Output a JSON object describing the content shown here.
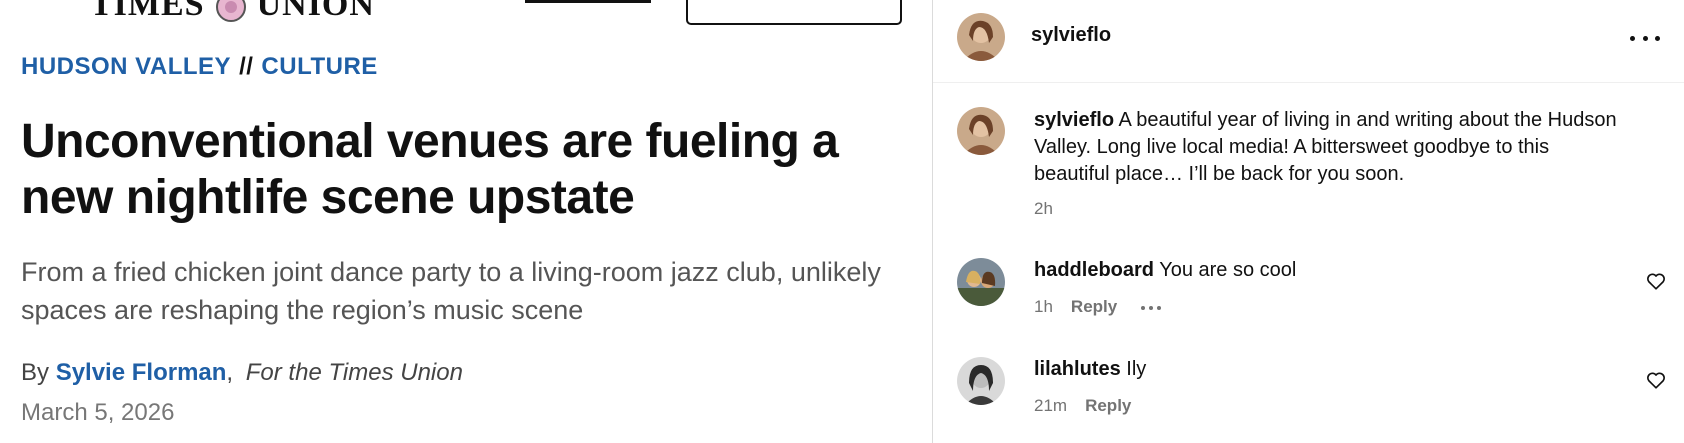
{
  "article": {
    "masthead_left": "TIMES",
    "masthead_right": "UNION",
    "kicker_section1": "HUDSON VALLEY",
    "kicker_separator": "//",
    "kicker_section2": "CULTURE",
    "headline": "Unconventional venues are fueling a new nightlife scene upstate",
    "dek": "From a fried chicken joint dance party to a living-room jazz club, unlikely spaces are reshaping the region’s music scene",
    "byline_prefix": "By",
    "author": "Sylvie Florman",
    "byline_comma": ",",
    "byline_for": "For the Times Union",
    "date": "March 5, 2026"
  },
  "instagram": {
    "post_author": "sylvieflo",
    "more_icon": "more-horizontal-icon",
    "caption": {
      "user": "sylvieflo",
      "text": "A beautiful year of living in and writing about the Hudson Valley. Long live local media! A bittersweet goodbye to this beautiful place… I’ll be back for you soon.",
      "time": "2h"
    },
    "comments": [
      {
        "user": "haddleboard",
        "text": "You are so cool",
        "time": "1h",
        "reply_label": "Reply"
      },
      {
        "user": "lilahlutes",
        "text": "Ily",
        "time": "21m",
        "reply_label": "Reply"
      }
    ]
  },
  "colors": {
    "accent_blue": "#1f5fa6",
    "meta_gray": "#737373",
    "divider": "#dbdbdb"
  }
}
